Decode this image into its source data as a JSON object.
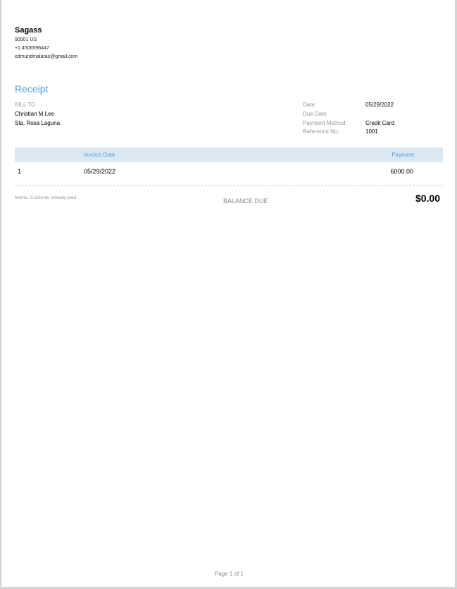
{
  "company": {
    "name": "Sagass",
    "address": "90001 US",
    "phone": "+1 4506596447",
    "email": "edmundmalaras@gmail.com"
  },
  "document_title": "Receipt",
  "bill_to": {
    "label": "BILL TO",
    "name": "Christian M Lee",
    "address": "Sta. Rosa Laguna"
  },
  "meta": [
    {
      "label": "Date:",
      "value": "05/29/2022"
    },
    {
      "label": "Due Date",
      "value": ""
    },
    {
      "label": "Payment Method:",
      "value": "Credit Card"
    },
    {
      "label": "Reference No:",
      "value": "1001"
    }
  ],
  "table": {
    "headers": [
      "",
      "Invoice Date",
      "Payment"
    ],
    "rows": [
      [
        "1",
        "05/29/2022",
        "6000.00"
      ]
    ]
  },
  "memo": "Memo: Customer already paid",
  "balance_due_label": "BALANCE DUE",
  "balance_due_value": "$0.00",
  "footer": "Page 1 of 1"
}
